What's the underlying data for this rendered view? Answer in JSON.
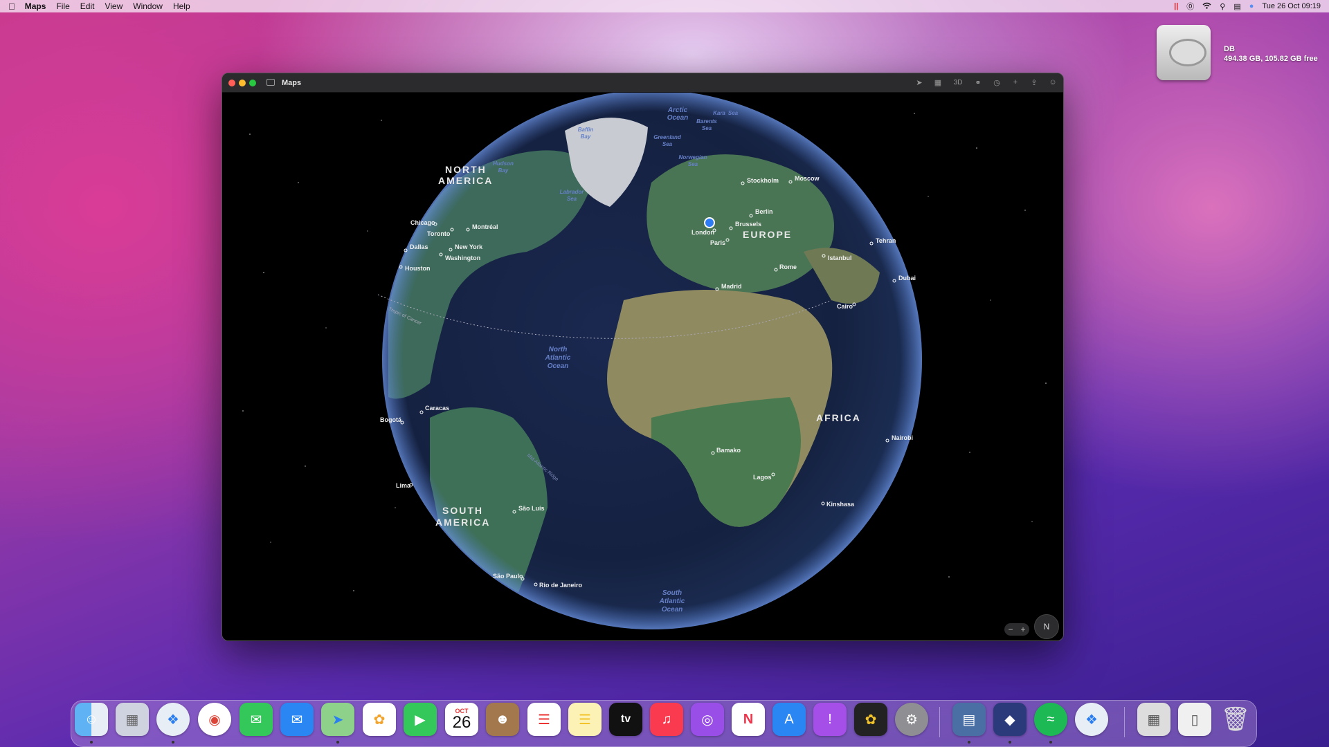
{
  "menubar": {
    "apple": "",
    "app_name": "Maps",
    "menus": [
      "File",
      "Edit",
      "View",
      "Window",
      "Help"
    ],
    "datetime": "Tue 26 Oct  09:19"
  },
  "desktop": {
    "disk_name": "DB",
    "disk_info": "494.38 GB, 105.82 GB free"
  },
  "window": {
    "title": "Maps",
    "toolbar_3d": "3D"
  },
  "map": {
    "regions": [
      {
        "name": "NORTH",
        "line2": "AMERICA"
      },
      {
        "name": "EUROPE"
      },
      {
        "name": "AFRICA"
      },
      {
        "name": "SOUTH",
        "line2": "AMERICA"
      }
    ],
    "oceans": [
      "North",
      "Atlantic",
      "Ocean",
      "South",
      "Atlantic",
      "Ocean",
      "Arctic",
      "Ocean",
      "Greenland",
      "Sea",
      "Norwegian",
      "Sea",
      "Labrador",
      "Sea",
      "Hudson",
      "Bay",
      "Baffin",
      "Bay",
      "Barents",
      "Sea",
      "Kara",
      "Sea"
    ],
    "cities": [
      "Stockholm",
      "Moscow",
      "Berlin",
      "Brussels",
      "London",
      "Paris",
      "Istanbul",
      "Tehran",
      "Dubai",
      "Rome",
      "Madrid",
      "Cairo",
      "Chicago",
      "Montréal",
      "Toronto",
      "Dallas",
      "New York",
      "Washington",
      "Houston",
      "Caracas",
      "Bogotá",
      "Lima",
      "São Luís",
      "São Paulo",
      "Rio de Janeiro",
      "Bamako",
      "Lagos",
      "Nairobi",
      "Kinshasa"
    ],
    "lines": [
      "Tropic of Cancer",
      "Mid-Atlantic Ridge"
    ],
    "compass": "N",
    "zoom_out": "−",
    "zoom_in": "+"
  },
  "dock": {
    "calendar_month": "OCT",
    "calendar_day": "26",
    "tv_label": "tv"
  }
}
